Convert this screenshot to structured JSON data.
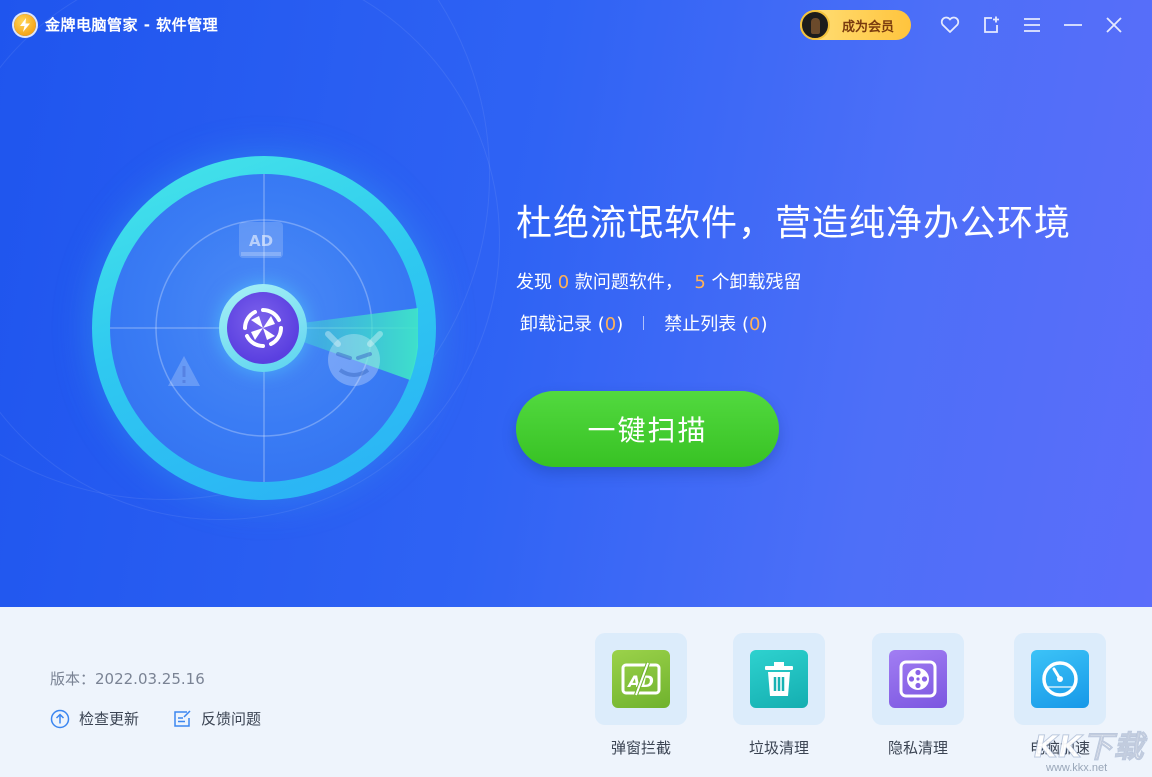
{
  "app": {
    "title": "金牌电脑管家 - 软件管理"
  },
  "titlebar": {
    "vip_label": "成为会员",
    "icons": [
      "favorite-icon",
      "share-icon",
      "menu-icon",
      "minimize-icon",
      "close-icon"
    ]
  },
  "hero": {
    "headline": "杜绝流氓软件，营造纯净办公环境",
    "stat": {
      "prefix": "发现 ",
      "problem_count": "0",
      "middle": " 款问题软件，  ",
      "residue_count": "5",
      "suffix": " 个卸载残留"
    },
    "links": {
      "uninstall_label": "卸载记录 (",
      "uninstall_count": "0",
      "uninstall_close": ")",
      "blocklist_label": "禁止列表 (",
      "blocklist_count": "0",
      "blocklist_close": ")"
    },
    "radar_badge": "AD",
    "scan_button": "一键扫描"
  },
  "footer": {
    "version": "版本：2022.03.25.16",
    "check_update": "检查更新",
    "feedback": "反馈问题",
    "tools": [
      {
        "label": "弹窗拦截",
        "icon": "popup-block-icon"
      },
      {
        "label": "垃圾清理",
        "icon": "trash-icon"
      },
      {
        "label": "隐私清理",
        "icon": "privacy-film-icon"
      },
      {
        "label": "电脑加速",
        "icon": "speedometer-icon"
      }
    ]
  },
  "watermark": {
    "big": "KK下载",
    "small": "www.kkx.net"
  },
  "colors": {
    "hero_start": "#1f55ee",
    "hero_end": "#5b6dfa",
    "scan_button": "#3fca2b",
    "highlight_number": "#ffb257",
    "vip_gold": "#ffc43d"
  }
}
